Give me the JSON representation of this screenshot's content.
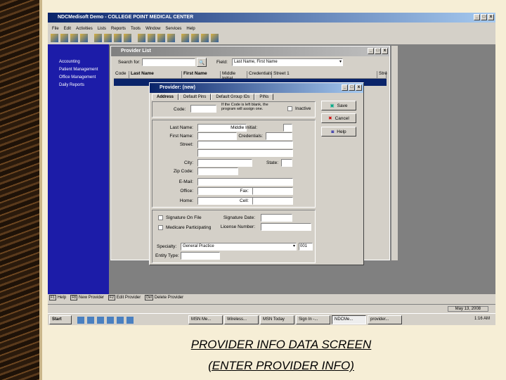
{
  "app": {
    "title": "NDCMedisoft Demo - COLLEGE POINT MEDICAL CENTER",
    "menu": [
      "File",
      "Edit",
      "Activities",
      "Lists",
      "Reports",
      "Tools",
      "Window",
      "Services",
      "Help"
    ]
  },
  "sidebar": {
    "items": [
      "Accounting",
      "Patient Management",
      "Office Management",
      "Daily Reports"
    ]
  },
  "provider_list": {
    "title": "Provider List",
    "search_label": "Search for:",
    "search_value": "",
    "field_label": "Field:",
    "field_value": "Last Name, First Name",
    "columns": [
      "Code",
      "Last Name",
      "First Name",
      "Middle Initial",
      "Credentials",
      "Street 1",
      "Stre"
    ]
  },
  "dialog": {
    "title": "Provider: (new)",
    "tabs": [
      "Address",
      "Default Pins",
      "Default Group IDs",
      "PINs"
    ],
    "code_label": "Code:",
    "code_note": "If the Code is left blank, the program will assign one.",
    "inactive_label": "Inactive",
    "labels": {
      "last_name": "Last Name:",
      "middle_initial": "Middle Initial:",
      "first_name": "First Name:",
      "credentials": "Credentials:",
      "street": "Street:",
      "city": "City:",
      "state": "State:",
      "zip": "Zip Code:",
      "email": "E-Mail:",
      "office": "Office:",
      "fax": "Fax:",
      "home": "Home:",
      "cell": "Cell:",
      "signature_on_file": "Signature On File",
      "signature_date": "Signature Date:",
      "medicare": "Medicare Participating",
      "license": "License Number:",
      "specialty": "Specialty:",
      "entity_type": "Entity Type:"
    },
    "specialty_value": "General Practice",
    "specialty_code": "001",
    "buttons": {
      "save": "Save",
      "cancel": "Cancel",
      "help": "Help"
    }
  },
  "function_keys": [
    {
      "key": "F1",
      "label": "Help"
    },
    {
      "key": "F8",
      "label": "New Provider"
    },
    {
      "key": "F2",
      "label": "Edit Provider"
    },
    {
      "key": "Del",
      "label": "Delete Provider"
    }
  ],
  "status": {
    "date": "May 13, 2008"
  },
  "taskbar": {
    "start": "Start",
    "tasks": [
      "MSN Me...",
      "Wireless...",
      "MSN Today",
      "Sign In -...",
      "NDCMe...",
      "provider..."
    ],
    "clock": "1:16 AM"
  },
  "caption": [
    "PROVIDER INFO DATA SCREEN",
    "(ENTER PROVIDER INFO)"
  ]
}
